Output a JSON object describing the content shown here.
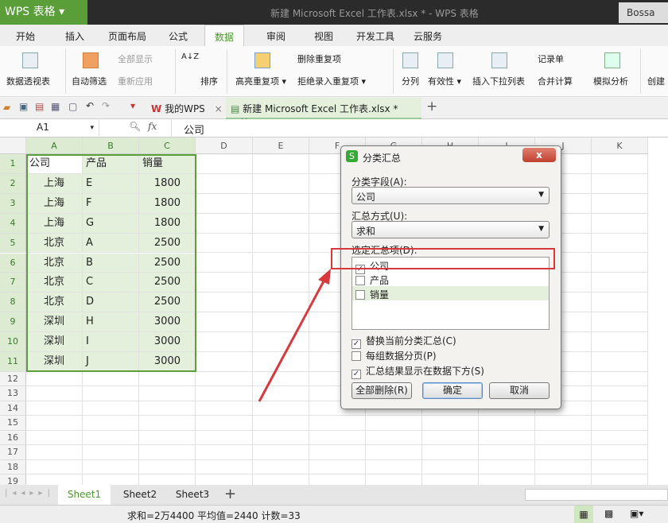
{
  "app": {
    "logo": "WPS 表格",
    "title": "新建 Microsoft Excel 工作表.xlsx * - WPS 表格",
    "user": "Bossa"
  },
  "menu": [
    "开始",
    "插入",
    "页面布局",
    "公式",
    "数据",
    "审阅",
    "视图",
    "开发工具",
    "云服务"
  ],
  "ribbon": {
    "pivot": "数据透视表",
    "autofilter": "自动筛选",
    "showall": "全部显示",
    "reapply": "重新应用",
    "sort": "排序",
    "highlight_dup": "高亮重复项 ▾",
    "remove_dup": "删除重复项",
    "reject_dup": "拒绝录入重复项 ▾",
    "split": "分列",
    "validity": "有效性 ▾",
    "dropdown": "插入下拉列表",
    "form": "记录单",
    "consolidate": "合并计算",
    "whatif": "模拟分析",
    "create": "创建"
  },
  "doc_tabs": [
    {
      "label": "我的WPS",
      "close": "×"
    },
    {
      "label": "新建 Microsoft Excel 工作表.xlsx *",
      "close": "×"
    }
  ],
  "new_tab": "+",
  "formula": {
    "cell_ref": "A1",
    "fx": "fx",
    "value": "公司"
  },
  "columns": [
    "A",
    "B",
    "C",
    "D",
    "E",
    "F",
    "G",
    "H",
    "I",
    "J",
    "K"
  ],
  "rows": [
    [
      "公司",
      "产品",
      "销量"
    ],
    [
      "上海",
      "E",
      "1800"
    ],
    [
      "上海",
      "F",
      "1800"
    ],
    [
      "上海",
      "G",
      "1800"
    ],
    [
      "北京",
      "A",
      "2500"
    ],
    [
      "北京",
      "B",
      "2500"
    ],
    [
      "北京",
      "C",
      "2500"
    ],
    [
      "北京",
      "D",
      "2500"
    ],
    [
      "深圳",
      "H",
      "3000"
    ],
    [
      "深圳",
      "I",
      "3000"
    ],
    [
      "深圳",
      "J",
      "3000"
    ]
  ],
  "row_numbers": [
    "1",
    "2",
    "3",
    "4",
    "5",
    "6",
    "7",
    "8",
    "9",
    "10",
    "11",
    "12",
    "13",
    "14",
    "15",
    "16",
    "17",
    "18",
    "19"
  ],
  "sheets": [
    "Sheet1",
    "Sheet2",
    "Sheet3"
  ],
  "add_sheet": "+",
  "status": "求和=2万4400  平均值=2440  计数=33",
  "dialog": {
    "title": "分类汇总",
    "close": "x",
    "field_label": "分类字段(A):",
    "field_value": "公司",
    "method_label": "汇总方式(U):",
    "method_value": "求和",
    "items_label": "选定汇总项(D):",
    "items": [
      {
        "label": "公司",
        "checked": true
      },
      {
        "label": "产品",
        "checked": false
      },
      {
        "label": "销量",
        "checked": false
      }
    ],
    "options": [
      {
        "label": "替换当前分类汇总(C)",
        "checked": true
      },
      {
        "label": "每组数据分页(P)",
        "checked": false
      },
      {
        "label": "汇总结果显示在数据下方(S)",
        "checked": true
      }
    ],
    "remove_all": "全部删除(R)",
    "ok": "确定",
    "cancel": "取消"
  },
  "colors": {
    "accent": "#5a9e3a",
    "annotation": "#d9393c"
  }
}
